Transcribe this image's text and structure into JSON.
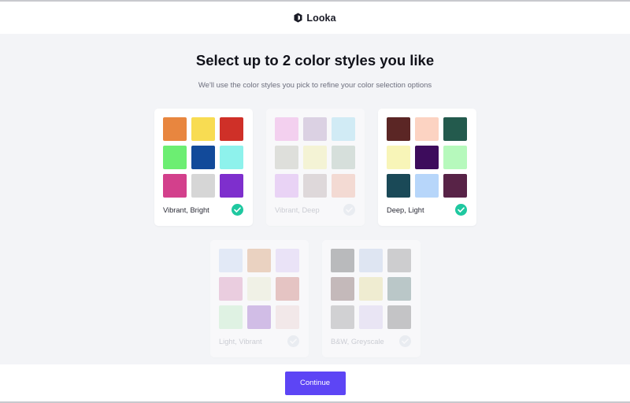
{
  "app": {
    "logo_text": "Looka",
    "logo_icon": "looka-logo-icon"
  },
  "page": {
    "title": "Select up to 2 color styles you like",
    "subtitle": "We'll use the color styles you pick to refine your color selection options"
  },
  "styles": [
    {
      "label": "Vibrant, Bright",
      "selected": true,
      "colors": [
        "#e8863f",
        "#f8dc52",
        "#cf3028",
        "#6cee72",
        "#124a9a",
        "#8ef2ec",
        "#d3408c",
        "#d6d6d6",
        "#7e2fcd"
      ]
    },
    {
      "label": "Vibrant, Deep",
      "selected": false,
      "colors": [
        "#f4a6e6",
        "#bfa8cc",
        "#a8e1f4",
        "#c6c6ba",
        "#f6f2ae",
        "#b4c7ba",
        "#deacf4",
        "#c5b7b8",
        "#f5bca8"
      ]
    },
    {
      "label": "Deep, Light",
      "selected": true,
      "colors": [
        "#5b2625",
        "#fcd3c2",
        "#235a4d",
        "#f8f5b8",
        "#3d0c5c",
        "#b6f9bc",
        "#1a4957",
        "#b7d6fa",
        "#582347"
      ]
    },
    {
      "label": "Light, Vibrant",
      "selected": false,
      "colors": [
        "#cfddf6",
        "#e0a981",
        "#e1d0f9",
        "#e09fc3",
        "#eeefd2",
        "#d58c86",
        "#c8f0cb",
        "#aa7bd2",
        "#f2dada"
      ]
    },
    {
      "label": "B&W, Greyscale",
      "selected": false,
      "colors": [
        "#757575",
        "#c6d4ec",
        "#a0a0a0",
        "#8d7272",
        "#ebe3a4",
        "#769290",
        "#a8a8a8",
        "#ddd3f1",
        "#8c8c8c"
      ]
    }
  ],
  "footer": {
    "continue_label": "Continue"
  },
  "theme": {
    "accent": "#5d45f5",
    "check": "#1fc8a0",
    "background": "#f3f4f7"
  }
}
